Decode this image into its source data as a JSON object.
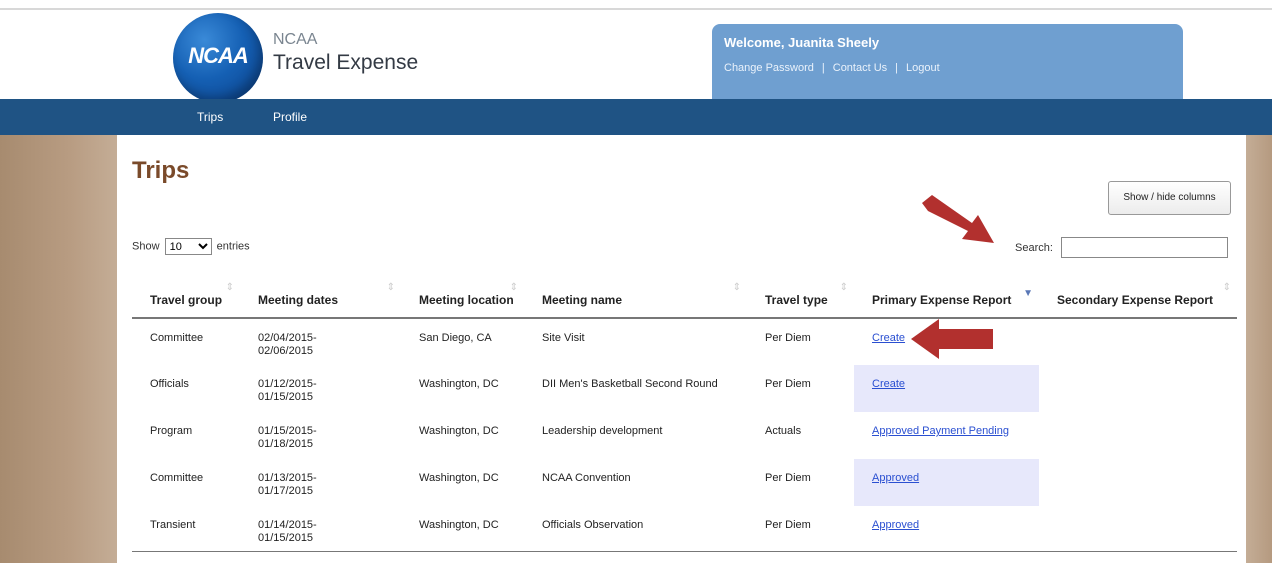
{
  "app": {
    "logo_text": "NCAA",
    "name_line1": "NCAA",
    "name_line2": "Travel Expense"
  },
  "account": {
    "welcome": "Welcome, Juanita Sheely",
    "links": [
      "Change Password",
      "Contact Us",
      "Logout"
    ]
  },
  "nav": {
    "items": [
      "Trips",
      "Profile"
    ]
  },
  "page": {
    "title": "Trips",
    "show_hide_label": "Show / hide columns",
    "length_prefix": "Show",
    "length_value": "10",
    "length_suffix": "entries",
    "search_label": "Search:",
    "search_value": ""
  },
  "table": {
    "columns": [
      {
        "label": "Travel group"
      },
      {
        "label": "Meeting dates"
      },
      {
        "label": "Meeting location"
      },
      {
        "label": "Meeting name"
      },
      {
        "label": "Travel type"
      },
      {
        "label": "Primary Expense Report"
      },
      {
        "label": "Secondary Expense Report"
      }
    ],
    "rows": [
      {
        "group": "Committee",
        "dates": "02/04/2015-\n02/06/2015",
        "location": "San Diego, CA",
        "name": "Site Visit",
        "type": "Per Diem",
        "primary": "Create",
        "secondary": ""
      },
      {
        "group": "Officials",
        "dates": "01/12/2015-\n01/15/2015",
        "location": "Washington, DC",
        "name": "DII Men's Basketball Second Round",
        "type": "Per Diem",
        "primary": "Create",
        "secondary": ""
      },
      {
        "group": "Program",
        "dates": "01/15/2015-\n01/18/2015",
        "location": "Washington, DC",
        "name": "Leadership development",
        "type": "Actuals",
        "primary": "Approved Payment Pending",
        "secondary": ""
      },
      {
        "group": "Committee",
        "dates": "01/13/2015-\n01/17/2015",
        "location": "Washington, DC",
        "name": "NCAA Convention",
        "type": "Per Diem",
        "primary": "Approved",
        "secondary": ""
      },
      {
        "group": "Transient",
        "dates": "01/14/2015-\n01/15/2015",
        "location": "Washington, DC",
        "name": "Officials Observation",
        "type": "Per Diem",
        "primary": "Approved",
        "secondary": ""
      }
    ]
  },
  "colors": {
    "navbar": "#1f5384",
    "welcome_box": "#6f9fd0",
    "title": "#7a4a2a",
    "annotation_arrow": "#b2302e",
    "sorted_column": "#dadcf7"
  }
}
